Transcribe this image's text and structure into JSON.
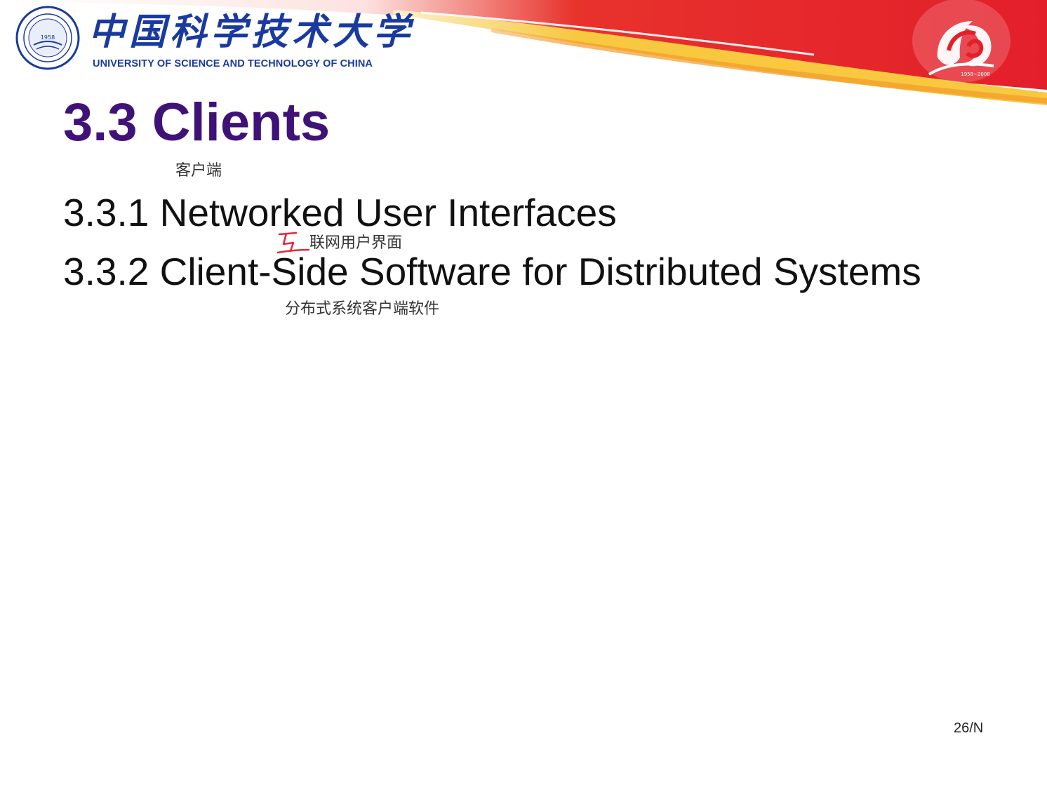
{
  "header": {
    "logo_cn": "中国科学技术大学",
    "logo_en": "UNIVERSITY OF SCIENCE AND TECHNOLOGY OF CHINA",
    "emblem_year": "1958",
    "anniversary_years": "1958~2008",
    "banner_colors": {
      "red": "#e8262b",
      "orange": "#f39a2a",
      "yellow": "#f7d33c"
    }
  },
  "slide": {
    "title": "3.3 Clients",
    "title_annotation": "客户端",
    "items": [
      {
        "text": "3.3.1 Networked User Interfaces",
        "annotation": "联网用户界面",
        "handwritten_mark": "互"
      },
      {
        "text": "3.3.2 Client-Side Software for Distributed Systems",
        "annotation": "分布式系统客户端软件"
      }
    ],
    "page_number": "26/N"
  },
  "colors": {
    "title": "#3f1278",
    "logo_blue": "#1a3aa0",
    "handwriting": "#e8263a"
  }
}
